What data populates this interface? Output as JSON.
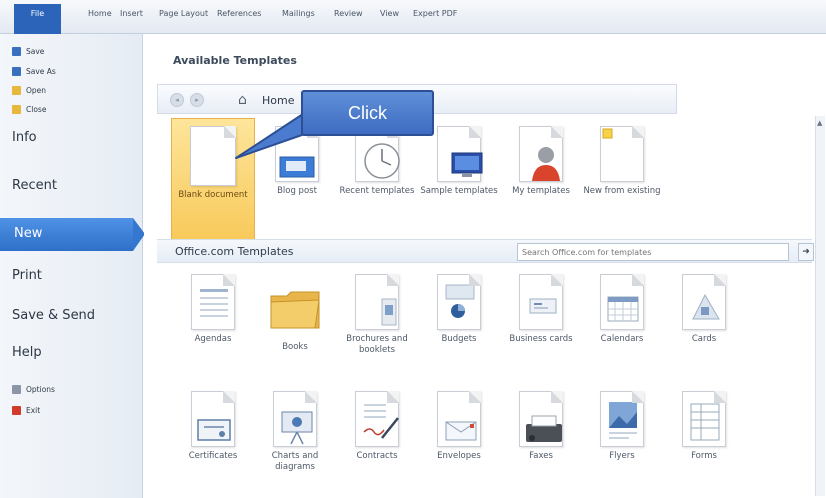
{
  "ribbon": {
    "file_tab": "File",
    "tabs": [
      {
        "label": "Home"
      },
      {
        "label": "Insert"
      },
      {
        "label": "Page Layout"
      },
      {
        "label": "References"
      },
      {
        "label": "Mailings"
      },
      {
        "label": "Review"
      },
      {
        "label": "View"
      },
      {
        "label": "Expert PDF"
      }
    ]
  },
  "sidebar": {
    "small_items": [
      {
        "label": "Save",
        "icon": "save-icon",
        "color": "#3a6fc0"
      },
      {
        "label": "Save As",
        "icon": "save-as-icon",
        "color": "#3a6fc0"
      },
      {
        "label": "Open",
        "icon": "open-folder-icon",
        "color": "#e7b83c"
      },
      {
        "label": "Close",
        "icon": "close-folder-icon",
        "color": "#e7b83c"
      }
    ],
    "items": [
      {
        "label": "Info"
      },
      {
        "label": "Recent"
      },
      {
        "label": "New",
        "selected": true
      },
      {
        "label": "Print"
      },
      {
        "label": "Save & Send"
      },
      {
        "label": "Help"
      }
    ],
    "bottom_items": [
      {
        "label": "Options",
        "icon": "options-icon",
        "color": "#8a96a6"
      },
      {
        "label": "Exit",
        "icon": "exit-icon",
        "color": "#d23a2a"
      }
    ]
  },
  "main": {
    "title": "Available Templates",
    "nav": {
      "back": "◂",
      "forward": "▸",
      "home_label": "Home"
    },
    "available_templates": [
      {
        "label": "Blank document",
        "icon": "blank-document-icon",
        "selected": true
      },
      {
        "label": "Blog post",
        "icon": "blog-post-icon"
      },
      {
        "label": "Recent templates",
        "icon": "recent-templates-icon"
      },
      {
        "label": "Sample templates",
        "icon": "sample-templates-icon"
      },
      {
        "label": "My templates",
        "icon": "my-templates-icon"
      },
      {
        "label": "New from existing",
        "icon": "new-from-existing-icon"
      }
    ],
    "office_section": {
      "title": "Office.com Templates",
      "search_placeholder": "Search Office.com for templates",
      "search_go": "➜"
    },
    "office_templates_row1": [
      {
        "label": "Agendas",
        "icon": "agendas-icon"
      },
      {
        "label": "Books",
        "icon": "books-folder-icon"
      },
      {
        "label": "Brochures and booklets",
        "icon": "brochures-icon"
      },
      {
        "label": "Budgets",
        "icon": "budgets-icon"
      },
      {
        "label": "Business cards",
        "icon": "business-cards-icon"
      },
      {
        "label": "Calendars",
        "icon": "calendars-icon"
      },
      {
        "label": "Cards",
        "icon": "cards-icon"
      }
    ],
    "office_templates_row2": [
      {
        "label": "Certificates",
        "icon": "certificates-icon"
      },
      {
        "label": "Charts and diagrams",
        "icon": "charts-diagrams-icon"
      },
      {
        "label": "Contracts",
        "icon": "contracts-icon"
      },
      {
        "label": "Envelopes",
        "icon": "envelopes-icon"
      },
      {
        "label": "Faxes",
        "icon": "faxes-icon"
      },
      {
        "label": "Flyers",
        "icon": "flyers-icon"
      },
      {
        "label": "Forms",
        "icon": "forms-icon"
      }
    ]
  },
  "callout": {
    "text": "Click",
    "color": "#4a7bcf"
  }
}
